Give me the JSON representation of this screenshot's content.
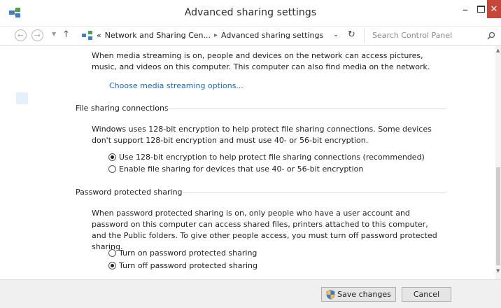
{
  "window": {
    "title": "Advanced sharing settings",
    "controls": {
      "minimize": "–",
      "maximize": "□",
      "close": "✕"
    }
  },
  "addressbar": {
    "path_prefix": "«",
    "breadcrumb": [
      "Network and Sharing Cen...",
      "Advanced sharing settings"
    ],
    "separator": "▸",
    "search_placeholder": "Search Control Panel"
  },
  "media": {
    "description": "When media streaming is on, people and devices on the network can access pictures, music, and videos on this computer. This computer can also find media on the network.",
    "link": "Choose media streaming options..."
  },
  "file_sharing": {
    "title": "File sharing connections",
    "description": "Windows uses 128-bit encryption to help protect file sharing connections. Some devices don't support 128-bit encryption and must use 40- or 56-bit encryption.",
    "options": [
      {
        "label": "Use 128-bit encryption to help protect file sharing connections (recommended)",
        "selected": true
      },
      {
        "label": "Enable file sharing for devices that use 40- or 56-bit encryption",
        "selected": false
      }
    ]
  },
  "password_sharing": {
    "title": "Password protected sharing",
    "description": "When password protected sharing is on, only people who have a user account and password on this computer can access shared files, printers attached to this computer, and the Public folders. To give other people access, you must turn off password protected sharing.",
    "options": [
      {
        "label": "Turn on password protected sharing",
        "selected": false
      },
      {
        "label": "Turn off password protected sharing",
        "selected": true
      }
    ]
  },
  "footer": {
    "save_label": "Save changes",
    "cancel_label": "Cancel"
  },
  "icons": {
    "app": "network-icon",
    "back": "back-arrow-icon",
    "forward": "forward-arrow-icon",
    "up": "up-arrow-icon",
    "refresh": "refresh-icon",
    "search": "search-icon",
    "shield": "uac-shield-icon"
  }
}
